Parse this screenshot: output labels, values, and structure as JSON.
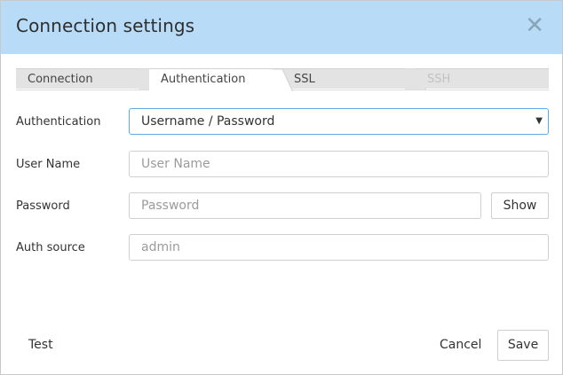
{
  "dialog": {
    "title": "Connection settings",
    "close_icon": "close-icon"
  },
  "tabs": [
    {
      "label": "Connection",
      "state": "inactive"
    },
    {
      "label": "Authentication",
      "state": "active"
    },
    {
      "label": "SSL",
      "state": "inactive"
    },
    {
      "label": "SSH",
      "state": "disabled"
    }
  ],
  "form": {
    "authentication": {
      "label": "Authentication",
      "value": "Username / Password"
    },
    "username": {
      "label": "User Name",
      "placeholder": "User Name"
    },
    "password": {
      "label": "Password",
      "placeholder": "Password",
      "show_label": "Show"
    },
    "auth_source": {
      "label": "Auth source",
      "placeholder": "admin"
    }
  },
  "footer": {
    "test_label": "Test",
    "cancel_label": "Cancel",
    "save_label": "Save"
  },
  "colors": {
    "header_bg": "#b8dcf7",
    "focus_border": "#5fa9e6"
  }
}
